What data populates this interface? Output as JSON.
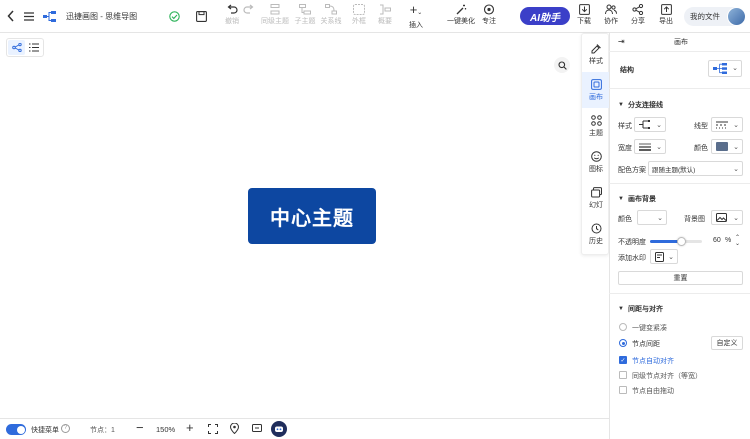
{
  "toolbar": {
    "title": "迅捷画图 - 思维导图",
    "buttons": {
      "undo": "撤销",
      "redo": "",
      "sibling": "同级主题",
      "child": "子主题",
      "relation": "关系线",
      "boundary": "外框",
      "summary": "概要",
      "insert": "插入",
      "beautify": "一键美化",
      "focus": "专注",
      "ai": "AI助手",
      "download": "下载",
      "collab": "协作",
      "share": "分享",
      "export": "导出",
      "myfiles": "我的文件"
    }
  },
  "canvas": {
    "central_topic": "中心主题"
  },
  "side_tabs": [
    {
      "label": "样式",
      "icon": "style-icon"
    },
    {
      "label": "画布",
      "icon": "canvas-icon",
      "active": true
    },
    {
      "label": "主题",
      "icon": "theme-icon"
    },
    {
      "label": "图标",
      "icon": "emoji-icon"
    },
    {
      "label": "幻灯",
      "icon": "slides-icon"
    },
    {
      "label": "历史",
      "icon": "history-icon"
    }
  ],
  "panel": {
    "header": "画布",
    "structure_label": "结构",
    "branch": {
      "title": "分支连接线",
      "style_label": "样式",
      "line_type_label": "线型",
      "width_label": "宽度",
      "color_label": "颜色",
      "color_value": "#5a6e8c",
      "scheme_label": "配色方案",
      "scheme_value": "跟随主题(默认)"
    },
    "background": {
      "title": "画布背景",
      "color_label": "颜色",
      "image_label": "背景图",
      "opacity_label": "不透明度",
      "opacity_value": "60",
      "opacity_unit": "%",
      "opacity_fraction": 0.6,
      "watermark_label": "添加水印",
      "reset_label": "重置"
    },
    "spacing": {
      "title": "间距与对齐",
      "compact_label": "一键变紧凑",
      "node_spacing_label": "节点间距",
      "custom_label": "自定义",
      "auto_align_label": "节点自动对齐",
      "sibling_align_label": "同级节点对齐（等宽）",
      "free_drag_label": "节点自由拖动"
    }
  },
  "status": {
    "shortcut_label": "快捷菜单",
    "node_count_label": "节点：1",
    "zoom": "150%"
  },
  "colors": {
    "accent": "#2f6bdc",
    "central_bg": "#0d47a1",
    "ai_bg": "#3b3fc8"
  }
}
